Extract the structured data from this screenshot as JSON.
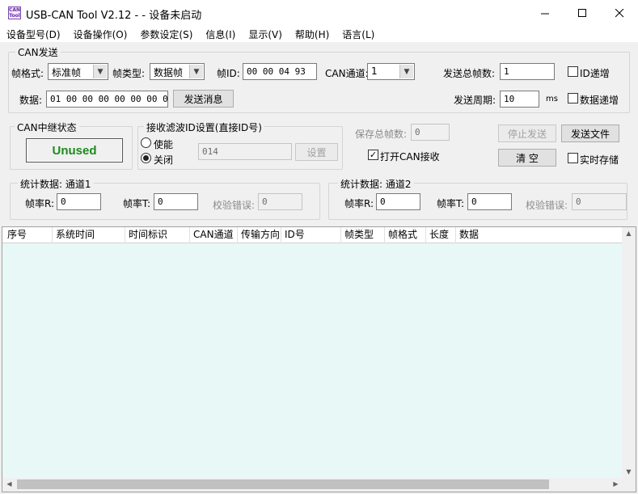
{
  "window": {
    "title": "USB-CAN Tool V2.12 -  - 设备未启动",
    "icon_text_top": "CAN",
    "icon_text_bottom": "Tool",
    "icons": [
      "app-icon",
      "minimize-icon",
      "maximize-icon",
      "close-icon"
    ]
  },
  "menu": [
    {
      "label": "设备型号(D)"
    },
    {
      "label": "设备操作(O)"
    },
    {
      "label": "参数设定(S)"
    },
    {
      "label": "信息(I)"
    },
    {
      "label": "显示(V)"
    },
    {
      "label": "帮助(H)"
    },
    {
      "label": "语言(L)"
    }
  ],
  "can_send": {
    "group_title": "CAN发送",
    "frame_format_label": "帧格式:",
    "frame_format_value": "标准帧",
    "frame_type_label": "帧类型:",
    "frame_type_value": "数据帧",
    "frame_id_label": "帧ID:",
    "frame_id_value": "00 00 04 93",
    "can_channel_label": "CAN通道:",
    "can_channel_value": "1",
    "send_total_label": "发送总帧数:",
    "send_total_value": "1",
    "id_increment_label": "ID递增",
    "data_label": "数据:",
    "data_value": "01 00 00 00 00 00 00 00",
    "send_button": "发送消息",
    "send_period_label": "发送周期:",
    "send_period_value": "10",
    "send_period_unit": "ms",
    "data_increment_label": "数据递增"
  },
  "relay": {
    "title": "CAN中继状态",
    "status": "Unused",
    "status_color": "#1c8a1c"
  },
  "filter": {
    "title": "接收滤波ID设置(直接ID号)",
    "enable_label": "使能",
    "disable_label": "关闭",
    "selected": "disable",
    "id_value": "014",
    "set_button": "设置"
  },
  "right_controls": {
    "save_total_label": "保存总帧数:",
    "save_total_value": "0",
    "open_receive_label": "打开CAN接收",
    "open_receive_checked": "✓",
    "stop_send_button": "停止发送",
    "send_file_button": "发送文件",
    "clear_button": "清 空",
    "realtime_save_label": "实时存储"
  },
  "stats1": {
    "title": "统计数据: 通道1",
    "rate_r_label": "帧率R:",
    "rate_r_value": "0",
    "rate_t_label": "帧率T:",
    "rate_t_value": "0",
    "check_error_label": "校验错误:",
    "check_error_value": "0"
  },
  "stats2": {
    "title": "统计数据: 通道2",
    "rate_r_label": "帧率R:",
    "rate_r_value": "0",
    "rate_t_label": "帧率T:",
    "rate_t_value": "0",
    "check_error_label": "校验错误:",
    "check_error_value": "0"
  },
  "table": {
    "columns": [
      "序号",
      "系统时间",
      "时间标识",
      "CAN通道",
      "传输方向",
      "ID号",
      "帧类型",
      "帧格式",
      "长度",
      "数据"
    ],
    "rows": [],
    "body_color": "#e8f8f6"
  }
}
